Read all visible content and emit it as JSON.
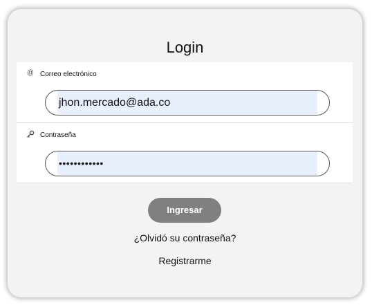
{
  "form": {
    "title": "Login",
    "email": {
      "icon": "at-icon",
      "label": "Correo electrónico",
      "value": "jhon.mercado@ada.co"
    },
    "password": {
      "icon": "key-icon",
      "label": "Contraseña",
      "masked_value": "••••••••••••"
    },
    "submit_label": "Ingresar",
    "forgot_label": "¿Olvidó su contraseña?",
    "register_label": "Registrarme"
  },
  "colors": {
    "card_background": "#f3f3f3",
    "autofill_background": "#e8f0fe",
    "button_background": "#808080",
    "button_text": "#ffffff"
  }
}
